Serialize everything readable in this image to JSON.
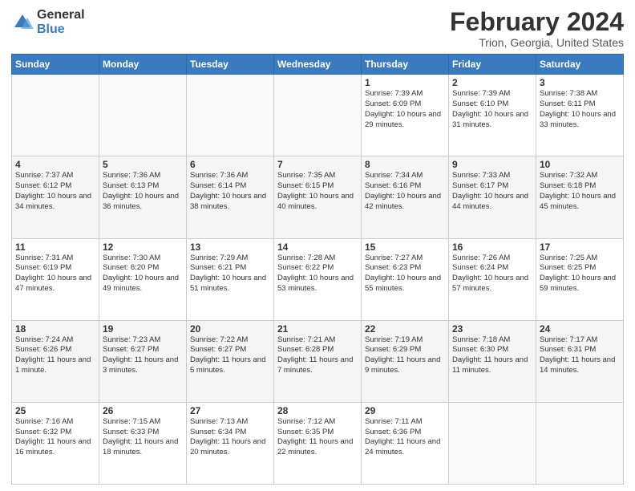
{
  "logo": {
    "general": "General",
    "blue": "Blue"
  },
  "title": "February 2024",
  "subtitle": "Trion, Georgia, United States",
  "headers": [
    "Sunday",
    "Monday",
    "Tuesday",
    "Wednesday",
    "Thursday",
    "Friday",
    "Saturday"
  ],
  "weeks": [
    [
      {
        "day": "",
        "sunrise": "",
        "sunset": "",
        "daylight": ""
      },
      {
        "day": "",
        "sunrise": "",
        "sunset": "",
        "daylight": ""
      },
      {
        "day": "",
        "sunrise": "",
        "sunset": "",
        "daylight": ""
      },
      {
        "day": "",
        "sunrise": "",
        "sunset": "",
        "daylight": ""
      },
      {
        "day": "1",
        "sunrise": "Sunrise: 7:39 AM",
        "sunset": "Sunset: 6:09 PM",
        "daylight": "Daylight: 10 hours and 29 minutes."
      },
      {
        "day": "2",
        "sunrise": "Sunrise: 7:39 AM",
        "sunset": "Sunset: 6:10 PM",
        "daylight": "Daylight: 10 hours and 31 minutes."
      },
      {
        "day": "3",
        "sunrise": "Sunrise: 7:38 AM",
        "sunset": "Sunset: 6:11 PM",
        "daylight": "Daylight: 10 hours and 33 minutes."
      }
    ],
    [
      {
        "day": "4",
        "sunrise": "Sunrise: 7:37 AM",
        "sunset": "Sunset: 6:12 PM",
        "daylight": "Daylight: 10 hours and 34 minutes."
      },
      {
        "day": "5",
        "sunrise": "Sunrise: 7:36 AM",
        "sunset": "Sunset: 6:13 PM",
        "daylight": "Daylight: 10 hours and 36 minutes."
      },
      {
        "day": "6",
        "sunrise": "Sunrise: 7:36 AM",
        "sunset": "Sunset: 6:14 PM",
        "daylight": "Daylight: 10 hours and 38 minutes."
      },
      {
        "day": "7",
        "sunrise": "Sunrise: 7:35 AM",
        "sunset": "Sunset: 6:15 PM",
        "daylight": "Daylight: 10 hours and 40 minutes."
      },
      {
        "day": "8",
        "sunrise": "Sunrise: 7:34 AM",
        "sunset": "Sunset: 6:16 PM",
        "daylight": "Daylight: 10 hours and 42 minutes."
      },
      {
        "day": "9",
        "sunrise": "Sunrise: 7:33 AM",
        "sunset": "Sunset: 6:17 PM",
        "daylight": "Daylight: 10 hours and 44 minutes."
      },
      {
        "day": "10",
        "sunrise": "Sunrise: 7:32 AM",
        "sunset": "Sunset: 6:18 PM",
        "daylight": "Daylight: 10 hours and 45 minutes."
      }
    ],
    [
      {
        "day": "11",
        "sunrise": "Sunrise: 7:31 AM",
        "sunset": "Sunset: 6:19 PM",
        "daylight": "Daylight: 10 hours and 47 minutes."
      },
      {
        "day": "12",
        "sunrise": "Sunrise: 7:30 AM",
        "sunset": "Sunset: 6:20 PM",
        "daylight": "Daylight: 10 hours and 49 minutes."
      },
      {
        "day": "13",
        "sunrise": "Sunrise: 7:29 AM",
        "sunset": "Sunset: 6:21 PM",
        "daylight": "Daylight: 10 hours and 51 minutes."
      },
      {
        "day": "14",
        "sunrise": "Sunrise: 7:28 AM",
        "sunset": "Sunset: 6:22 PM",
        "daylight": "Daylight: 10 hours and 53 minutes."
      },
      {
        "day": "15",
        "sunrise": "Sunrise: 7:27 AM",
        "sunset": "Sunset: 6:23 PM",
        "daylight": "Daylight: 10 hours and 55 minutes."
      },
      {
        "day": "16",
        "sunrise": "Sunrise: 7:26 AM",
        "sunset": "Sunset: 6:24 PM",
        "daylight": "Daylight: 10 hours and 57 minutes."
      },
      {
        "day": "17",
        "sunrise": "Sunrise: 7:25 AM",
        "sunset": "Sunset: 6:25 PM",
        "daylight": "Daylight: 10 hours and 59 minutes."
      }
    ],
    [
      {
        "day": "18",
        "sunrise": "Sunrise: 7:24 AM",
        "sunset": "Sunset: 6:26 PM",
        "daylight": "Daylight: 11 hours and 1 minute."
      },
      {
        "day": "19",
        "sunrise": "Sunrise: 7:23 AM",
        "sunset": "Sunset: 6:27 PM",
        "daylight": "Daylight: 11 hours and 3 minutes."
      },
      {
        "day": "20",
        "sunrise": "Sunrise: 7:22 AM",
        "sunset": "Sunset: 6:27 PM",
        "daylight": "Daylight: 11 hours and 5 minutes."
      },
      {
        "day": "21",
        "sunrise": "Sunrise: 7:21 AM",
        "sunset": "Sunset: 6:28 PM",
        "daylight": "Daylight: 11 hours and 7 minutes."
      },
      {
        "day": "22",
        "sunrise": "Sunrise: 7:19 AM",
        "sunset": "Sunset: 6:29 PM",
        "daylight": "Daylight: 11 hours and 9 minutes."
      },
      {
        "day": "23",
        "sunrise": "Sunrise: 7:18 AM",
        "sunset": "Sunset: 6:30 PM",
        "daylight": "Daylight: 11 hours and 11 minutes."
      },
      {
        "day": "24",
        "sunrise": "Sunrise: 7:17 AM",
        "sunset": "Sunset: 6:31 PM",
        "daylight": "Daylight: 11 hours and 14 minutes."
      }
    ],
    [
      {
        "day": "25",
        "sunrise": "Sunrise: 7:16 AM",
        "sunset": "Sunset: 6:32 PM",
        "daylight": "Daylight: 11 hours and 16 minutes."
      },
      {
        "day": "26",
        "sunrise": "Sunrise: 7:15 AM",
        "sunset": "Sunset: 6:33 PM",
        "daylight": "Daylight: 11 hours and 18 minutes."
      },
      {
        "day": "27",
        "sunrise": "Sunrise: 7:13 AM",
        "sunset": "Sunset: 6:34 PM",
        "daylight": "Daylight: 11 hours and 20 minutes."
      },
      {
        "day": "28",
        "sunrise": "Sunrise: 7:12 AM",
        "sunset": "Sunset: 6:35 PM",
        "daylight": "Daylight: 11 hours and 22 minutes."
      },
      {
        "day": "29",
        "sunrise": "Sunrise: 7:11 AM",
        "sunset": "Sunset: 6:36 PM",
        "daylight": "Daylight: 11 hours and 24 minutes."
      },
      {
        "day": "",
        "sunrise": "",
        "sunset": "",
        "daylight": ""
      },
      {
        "day": "",
        "sunrise": "",
        "sunset": "",
        "daylight": ""
      }
    ]
  ]
}
